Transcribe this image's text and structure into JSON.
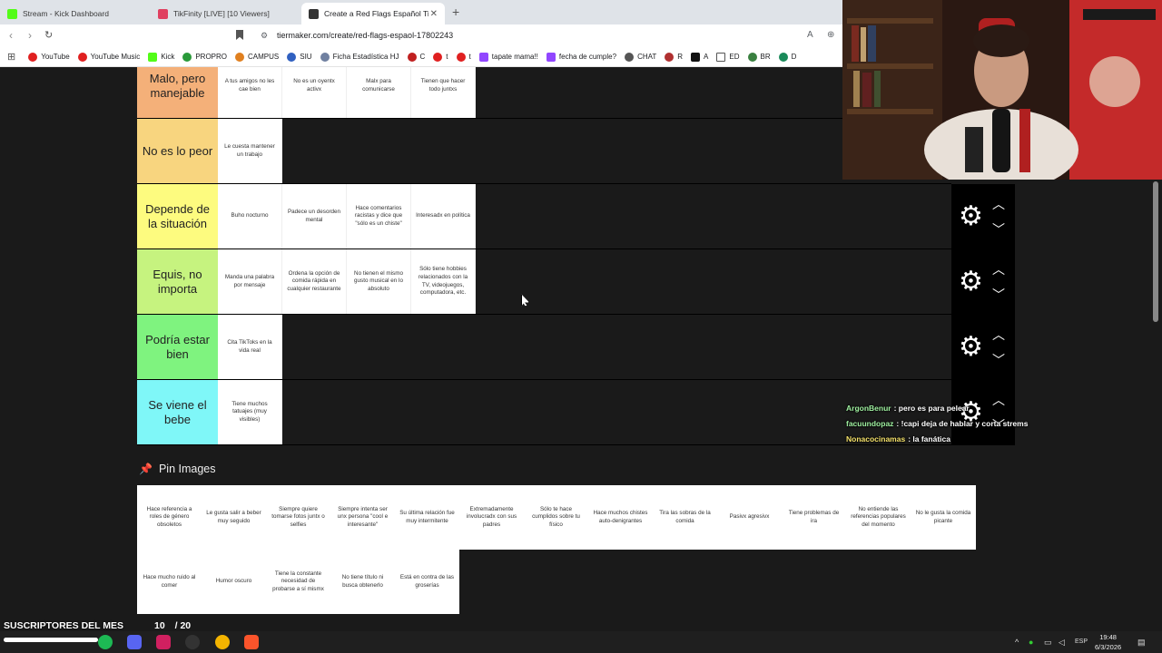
{
  "browser": {
    "tabs": [
      {
        "title": "Stream - Kick Dashboard",
        "color": "#53fc18"
      },
      {
        "title": "TikFinity [LIVE] [10 Viewers]",
        "color": "#e04060"
      },
      {
        "title": "Create a Red Flags Español Tier",
        "color": "#333333"
      }
    ],
    "url": "tiermaker.com/create/red-flags-espaol-17802243",
    "bookmarks": [
      "YouTube",
      "YouTube Music",
      "Kick",
      "PROPRO",
      "CAMPUS",
      "SIU",
      "Ficha Estadística HJ",
      "C",
      "t",
      "t",
      "tapate mama!!",
      "fecha de cumple?",
      "CHAT",
      "R",
      "A",
      "ED",
      "BR",
      "D"
    ]
  },
  "tiers": [
    {
      "label": "Malo, pero manejable",
      "color": "#f4b079",
      "items": [
        "A tus amigos no les cae bien",
        "No es un oyentx activx",
        "Malx para comunicarse",
        "Tienen que hacer todo juntxs"
      ]
    },
    {
      "label": "No es lo peor",
      "color": "#f8d57f",
      "items": [
        "Le cuesta mantener un trabajo"
      ]
    },
    {
      "label": "Depende de la situación",
      "color": "#fdfb7f",
      "items": [
        "Buho nocturno",
        "Padece un desorden mental",
        "Hace comentarios racistas y dice que \"sólo es un chiste\"",
        "Interesadx en política"
      ]
    },
    {
      "label": "Equis, no importa",
      "color": "#c6f37f",
      "items": [
        "Manda una palabra por mensaje",
        "Ordena la opción de comida rápida en cualquier restaurante",
        "No tienen el mismo gusto musical en lo absoluto",
        "Sólo tiene hobbies relacionados con la TV, videojuegos, computadora, etc."
      ]
    },
    {
      "label": "Podría estar bien",
      "color": "#7ff37f",
      "items": [
        "Cita TikToks en la vida real"
      ]
    },
    {
      "label": "Se viene el bebe",
      "color": "#7ff7f8",
      "items": [
        "Tiene muchos tatuajes (muy visibles)"
      ]
    }
  ],
  "pin": {
    "title": "Pin Images",
    "items": [
      "Hace referencia a roles de género obsoletos",
      "Le gusta salir a beber muy seguido",
      "Siempre quiere tomarse fotos juntx o selfies",
      "Siempre intenta ser unx persona \"cool e interesante\"",
      "Su última relación fue muy intermitente",
      "Extremadamente involucradx con sus padres",
      "Sólo te hace cumplidos sobre tu físico",
      "Hace muchos chistes auto-denigrantes",
      "Tira las sobras de la comida",
      "Pasivx agresivx",
      "Tiene problemas de ira",
      "No entiende las referencias populares del momento",
      "No le gusta la comida picante",
      "Hace mucho ruido al comer",
      "Humor oscuro",
      "Tiene la constante necesidad de probarse a sí mismx",
      "No tiene título ni busca obtenerlo",
      "Está en contra de las groserías"
    ]
  },
  "chat": [
    {
      "user": "ArgonBenur",
      "msg": ": pero es para pelear",
      "color": "#9ff0a0"
    },
    {
      "user": "facuundopaz",
      "msg": ": !capi deja de hablar y corta strems",
      "color": "#9ff0a0"
    },
    {
      "user": "Nonacocinamas",
      "msg": ": la fanática",
      "color": "#f6e36b"
    }
  ],
  "overlay": {
    "subs_label": "SUSCRIPTORES DEL MES",
    "subs_count": "10",
    "subs_goal": "/ 20"
  },
  "taskbar": {
    "lang": "ESP",
    "time": "19:48",
    "date": "6/3/2026"
  }
}
